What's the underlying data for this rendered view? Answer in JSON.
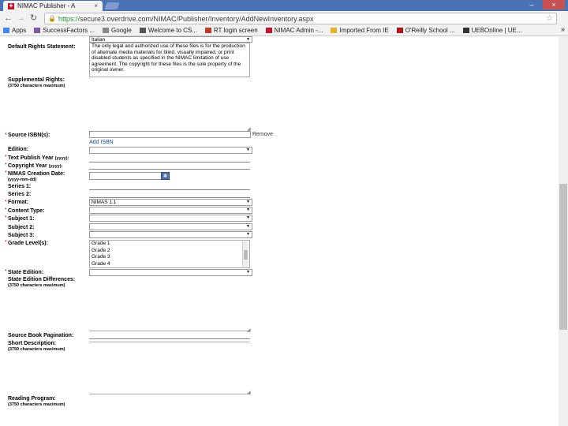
{
  "browser": {
    "tab_title": "NIMAC Publisher - A",
    "tab_close": "×",
    "window_min": "–",
    "window_close": "×",
    "url_https": "https://",
    "url_rest": "secure3.overdrive.com/NIMAC/Publisher/Inventory/AddNewInventory.aspx",
    "bookmarks": [
      {
        "label": "Apps",
        "color": "#4285f4"
      },
      {
        "label": "SuccessFactors ...",
        "color": "#7a5aa6"
      },
      {
        "label": "Google",
        "color": "#888888"
      },
      {
        "label": "Welcome to CS...",
        "color": "#555555"
      },
      {
        "label": "RT login screen",
        "color": "#c0392b"
      },
      {
        "label": "NIMAC Admin -...",
        "color": "#c8102e"
      },
      {
        "label": "Imported From IE",
        "color": "#e6b422"
      },
      {
        "label": "O'Reilly School ...",
        "color": "#b5121b"
      },
      {
        "label": "UEBOnline | UE...",
        "color": "#333333"
      }
    ],
    "bookmarks_more": "»"
  },
  "form": {
    "language_value": "Italian",
    "default_rights_label": "Default Rights Statement:",
    "default_rights_text": "The only legal and authorized use of these files is for the production of alternate media materials for blind, visually impaired, or print disabled students as specified in the NIMAC limitation of use agreement. The copyright for these files is the sole property of the original owner.",
    "supplemental_rights_label": "Supplemental Rights:",
    "char_max": "(3750 characters maximum)",
    "source_isbn_label": "Source ISBN(s):",
    "remove_link": "Remove",
    "add_isbn_link": "Add ISBN",
    "edition_label": "Edition:",
    "text_publish_year_label": "Text Publish Year",
    "yyyy": "(yyyy):",
    "copyright_year_label": "Copyright Year",
    "nimas_creation_label": "NIMAS Creation Date:",
    "date_hint": "(yyyy-mm-dd)",
    "series1_label": "Series 1:",
    "series2_label": "Series 2:",
    "format_label": "Format:",
    "format_value": "NIMAS 1.1",
    "content_type_label": "Content Type:",
    "subject1_label": "Subject 1:",
    "subject2_label": "Subject 2:",
    "subject3_label": "Subject 3:",
    "grade_levels_label": "Grade Level(s):",
    "grade_options": [
      "Grade 1",
      "Grade 2",
      "Grade 3",
      "Grade 4"
    ],
    "state_edition_label": "State Edition:",
    "state_edition_diff_label": "State Edition Differences:",
    "source_pagination_label": "Source Book Pagination:",
    "short_description_label": "Short Description:",
    "reading_program_label": "Reading Program:",
    "required_mark": "*"
  }
}
